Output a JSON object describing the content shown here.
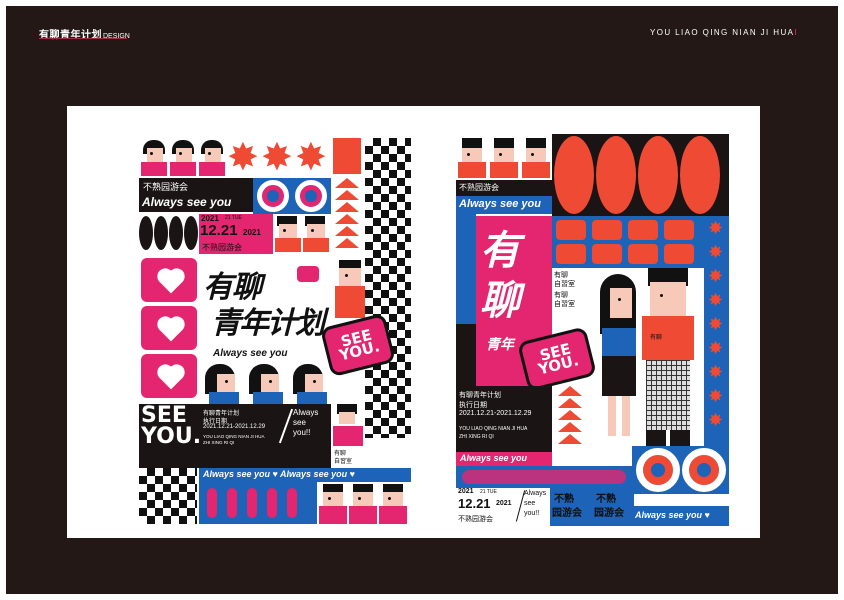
{
  "header": {
    "title_cn": "有聊青年计划",
    "title_en": "DESIGN",
    "pinyin": "YOU LIAO QING NIAN JI HUA",
    "pinyin_accent": "I"
  },
  "poster_left": {
    "event_name": "不熟园游会",
    "tagline": "Always see you",
    "date_small": "2021",
    "day": "21 TUE",
    "date_big": "12.21",
    "date_year": "2021",
    "event_name_2": "不熟园游会",
    "title_line1": "有聊",
    "title_line2": "青年计划",
    "bubble_text": "SEE YOU.",
    "tagline_2": "Always see you",
    "see_you": "SEE YOU.",
    "project": "有聊青年计划",
    "exec_date_label": "执行日期",
    "date_range": "2021.12.21-2021.12.29",
    "pinyin_1": "YOU LIAO QING NIAN JI HUA",
    "pinyin_2": "ZHI XING RI QI",
    "always": "Always",
    "see": "see",
    "you_excl": "you!!",
    "small_sign_1": "有聊",
    "small_sign_2": "自習室",
    "bottom_tagline": "Always see you ♥  Always see you ♥",
    "heart_glyph": "♥"
  },
  "poster_right": {
    "event_name": "不熟园游会",
    "tagline": "Always see you",
    "big_title_1": "有",
    "big_title_2": "聊",
    "big_title_3": "青年",
    "sign_1": "有聊",
    "sign_2": "自習室",
    "sign_3": "有聊",
    "sign_4": "自習室",
    "shirt_label": "有聊",
    "bubble_text": "SEE YOU.",
    "project": "有聊青年计划",
    "exec_date_label": "执行日期",
    "date_range": "2021.12.21-2021.12.29",
    "pinyin_1": "YOU LIAO QING NIAN JI HUA",
    "pinyin_2": "ZHI XING RI QI",
    "tagline_2": "Always see you",
    "date_small": "2021",
    "day": "21 TUE",
    "date_big": "12.21",
    "date_year": "2021",
    "event_name_2": "不熟园游会",
    "always": "Always",
    "see": "see",
    "you_excl": "you!!",
    "block_1a": "不熟",
    "block_1b": "园游会",
    "block_2a": "不熟",
    "block_2b": "园游会",
    "bottom_tagline": "Always see you ♥"
  },
  "colors": {
    "frame": "#231816",
    "pink": "#e3266f",
    "blue": "#1d63b8",
    "red": "#ef4a33",
    "black": "#1a1414"
  }
}
